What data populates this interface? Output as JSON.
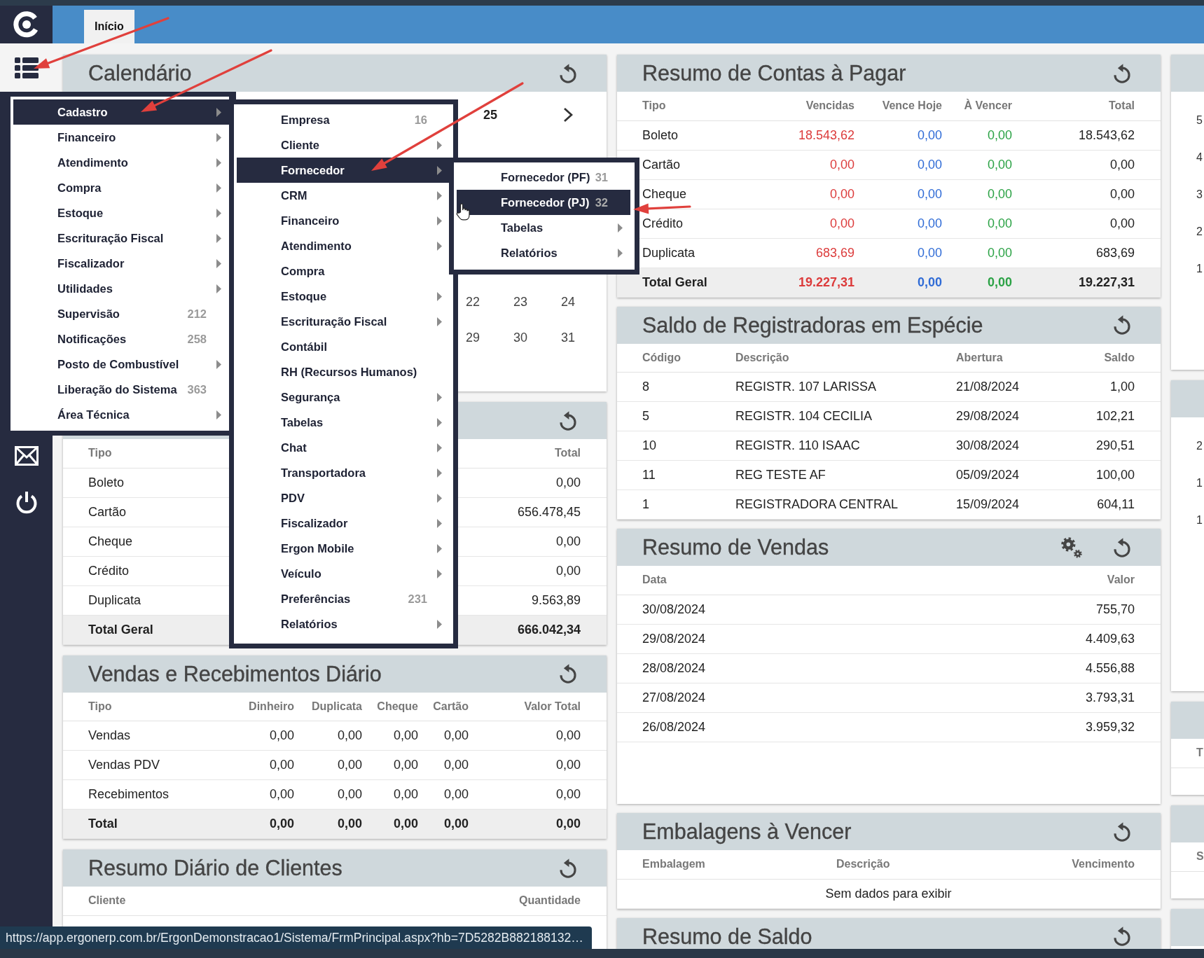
{
  "header": {
    "tabs": [
      {
        "label": "Início",
        "selected": true
      }
    ]
  },
  "menu": {
    "items": [
      {
        "label": "Cadastro",
        "has_submenu": true,
        "selected": true,
        "children": [
          {
            "label": "Empresa",
            "count": "16",
            "has_submenu": false,
            "selected": false
          },
          {
            "label": "Cliente",
            "has_submenu": true,
            "selected": false
          },
          {
            "label": "Fornecedor",
            "has_submenu": true,
            "selected": true,
            "children": [
              {
                "label": "Fornecedor (PF)",
                "count": "31",
                "has_submenu": false,
                "selected": false
              },
              {
                "label": "Fornecedor (PJ)",
                "count": "32",
                "has_submenu": false,
                "selected": true
              },
              {
                "label": "Tabelas",
                "has_submenu": true,
                "selected": false
              },
              {
                "label": "Relatórios",
                "has_submenu": true,
                "selected": false
              }
            ]
          },
          {
            "label": "CRM",
            "has_submenu": true,
            "selected": false
          },
          {
            "label": "Financeiro",
            "has_submenu": true,
            "selected": false
          },
          {
            "label": "Atendimento",
            "has_submenu": true,
            "selected": false
          },
          {
            "label": "Compra",
            "has_submenu": false,
            "selected": false
          },
          {
            "label": "Estoque",
            "has_submenu": true,
            "selected": false
          },
          {
            "label": "Escrituração Fiscal",
            "has_submenu": true,
            "selected": false
          },
          {
            "label": "Contábil",
            "has_submenu": false,
            "selected": false
          },
          {
            "label": "RH (Recursos Humanos)",
            "has_submenu": false,
            "selected": false
          },
          {
            "label": "Segurança",
            "has_submenu": true,
            "selected": false
          },
          {
            "label": "Tabelas",
            "has_submenu": true,
            "selected": false
          },
          {
            "label": "Chat",
            "has_submenu": true,
            "selected": false
          },
          {
            "label": "Transportadora",
            "has_submenu": true,
            "selected": false
          },
          {
            "label": "PDV",
            "has_submenu": true,
            "selected": false
          },
          {
            "label": "Fiscalizador",
            "has_submenu": true,
            "selected": false
          },
          {
            "label": "Ergon Mobile",
            "has_submenu": true,
            "selected": false
          },
          {
            "label": "Veículo",
            "has_submenu": true,
            "selected": false
          },
          {
            "label": "Preferências",
            "count": "231",
            "has_submenu": false,
            "selected": false
          },
          {
            "label": "Relatórios",
            "has_submenu": true,
            "selected": false
          }
        ]
      },
      {
        "label": "Financeiro",
        "has_submenu": true,
        "selected": false
      },
      {
        "label": "Atendimento",
        "has_submenu": true,
        "selected": false
      },
      {
        "label": "Compra",
        "has_submenu": true,
        "selected": false
      },
      {
        "label": "Estoque",
        "has_submenu": true,
        "selected": false
      },
      {
        "label": "Escrituração Fiscal",
        "has_submenu": true,
        "selected": false
      },
      {
        "label": "Fiscalizador",
        "has_submenu": true,
        "selected": false
      },
      {
        "label": "Utilidades",
        "has_submenu": true,
        "selected": false
      },
      {
        "label": "Supervisão",
        "count": "212",
        "has_submenu": false,
        "selected": false
      },
      {
        "label": "Notificações",
        "count": "258",
        "has_submenu": false,
        "selected": false
      },
      {
        "label": "Posto de Combustível",
        "has_submenu": true,
        "selected": false
      },
      {
        "label": "Liberação do Sistema",
        "count": "363",
        "has_submenu": false,
        "selected": false
      },
      {
        "label": "Área Técnica",
        "has_submenu": true,
        "selected": false
      }
    ]
  },
  "dashboard": {
    "columns": [
      {
        "panels": [
          {
            "kind": "calendar",
            "title": "Calendário",
            "refresh_button": true,
            "month_label": "25",
            "weeks": [
              [
                "22",
                "23",
                "24"
              ],
              [
                "29",
                "30",
                "31"
              ]
            ]
          },
          {
            "kind": "table",
            "refresh_button": true,
            "columns": [
              {
                "label": "Tipo",
                "kind": "text"
              },
              {
                "label": "Total",
                "kind": "number"
              }
            ],
            "rows": [
              {
                "cells": [
                  "Boleto",
                  "0,00"
                ],
                "total": false
              },
              {
                "cells": [
                  "Cartão",
                  "656.478,45"
                ],
                "total": false
              },
              {
                "cells": [
                  "Cheque",
                  "0,00"
                ],
                "total": false
              },
              {
                "cells": [
                  "Crédito",
                  "0,00"
                ],
                "total": false
              },
              {
                "cells": [
                  "Duplicata",
                  "9.563,89"
                ],
                "total": false
              },
              {
                "cells": [
                  "Total Geral",
                  "666.042,34"
                ],
                "total": true
              }
            ]
          },
          {
            "kind": "table",
            "title": "Vendas e Recebimentos Diário",
            "refresh_button": true,
            "columns": [
              {
                "label": "Tipo",
                "kind": "text"
              },
              {
                "label": "Dinheiro",
                "kind": "number"
              },
              {
                "label": "Duplicata",
                "kind": "number"
              },
              {
                "label": "Cheque",
                "kind": "number"
              },
              {
                "label": "Cartão",
                "kind": "number"
              },
              {
                "label": "Valor Total",
                "kind": "number"
              }
            ],
            "rows": [
              {
                "cells": [
                  "Vendas",
                  "0,00",
                  "0,00",
                  "0,00",
                  "0,00",
                  "0,00"
                ],
                "total": false
              },
              {
                "cells": [
                  "Vendas PDV",
                  "0,00",
                  "0,00",
                  "0,00",
                  "0,00",
                  "0,00"
                ],
                "total": false
              },
              {
                "cells": [
                  "Recebimentos",
                  "0,00",
                  "0,00",
                  "0,00",
                  "0,00",
                  "0,00"
                ],
                "total": false
              },
              {
                "cells": [
                  "Total",
                  "0,00",
                  "0,00",
                  "0,00",
                  "0,00",
                  "0,00"
                ],
                "total": true
              }
            ]
          },
          {
            "kind": "table",
            "title": "Resumo Diário de Clientes",
            "refresh_button": true,
            "columns": [
              {
                "label": "Cliente",
                "kind": "text"
              },
              {
                "label": "Quantidade",
                "kind": "number"
              }
            ]
          }
        ]
      },
      {
        "panels": [
          {
            "kind": "table",
            "title": "Resumo de Contas à Pagar",
            "refresh_button": true,
            "columns": [
              {
                "label": "Tipo",
                "kind": "text"
              },
              {
                "label": "Vencidas",
                "kind": "number",
                "color": "#dc3b3b"
              },
              {
                "label": "Vence Hoje",
                "kind": "number",
                "color": "#2f6bd6"
              },
              {
                "label": "À Vencer",
                "kind": "number",
                "color": "#2ba245"
              },
              {
                "label": "Total",
                "kind": "number"
              }
            ],
            "rows": [
              {
                "cells": [
                  "Boleto",
                  "18.543,62",
                  "0,00",
                  "0,00",
                  "18.543,62"
                ],
                "total": false
              },
              {
                "cells": [
                  "Cartão",
                  "0,00",
                  "0,00",
                  "0,00",
                  "0,00"
                ],
                "total": false
              },
              {
                "cells": [
                  "Cheque",
                  "0,00",
                  "0,00",
                  "0,00",
                  "0,00"
                ],
                "total": false
              },
              {
                "cells": [
                  "Crédito",
                  "0,00",
                  "0,00",
                  "0,00",
                  "0,00"
                ],
                "total": false
              },
              {
                "cells": [
                  "Duplicata",
                  "683,69",
                  "0,00",
                  "0,00",
                  "683,69"
                ],
                "total": false
              },
              {
                "cells": [
                  "Total Geral",
                  "19.227,31",
                  "0,00",
                  "0,00",
                  "19.227,31"
                ],
                "total": true
              }
            ]
          },
          {
            "kind": "table",
            "title": "Saldo de Registradoras em Espécie",
            "refresh_button": true,
            "columns": [
              {
                "label": "Código",
                "kind": "text"
              },
              {
                "label": "Descrição",
                "kind": "text"
              },
              {
                "label": "Abertura",
                "kind": "date"
              },
              {
                "label": "Saldo",
                "kind": "number"
              }
            ],
            "rows": [
              {
                "cells": [
                  "8",
                  "REGISTR. 107 LARISSA",
                  "21/08/2024",
                  "1,00"
                ],
                "total": false
              },
              {
                "cells": [
                  "5",
                  "REGISTR. 104 CECILIA",
                  "29/08/2024",
                  "102,21"
                ],
                "total": false
              },
              {
                "cells": [
                  "10",
                  "REGISTR. 110 ISAAC",
                  "30/08/2024",
                  "290,51"
                ],
                "total": false
              },
              {
                "cells": [
                  "11",
                  "REG TESTE AF",
                  "05/09/2024",
                  "100,00"
                ],
                "total": false
              },
              {
                "cells": [
                  "1",
                  "REGISTRADORA CENTRAL",
                  "15/09/2024",
                  "604,11"
                ],
                "total": false
              }
            ]
          },
          {
            "kind": "table",
            "title": "Resumo de Vendas",
            "settings_button": true,
            "refresh_button": true,
            "columns": [
              {
                "label": "Data",
                "kind": "date"
              },
              {
                "label": "Valor",
                "kind": "number"
              }
            ],
            "rows": [
              {
                "cells": [
                  "30/08/2024",
                  "755,70"
                ],
                "total": false
              },
              {
                "cells": [
                  "29/08/2024",
                  "4.409,63"
                ],
                "total": false
              },
              {
                "cells": [
                  "28/08/2024",
                  "4.556,88"
                ],
                "total": false
              },
              {
                "cells": [
                  "27/08/2024",
                  "3.793,31"
                ],
                "total": false
              },
              {
                "cells": [
                  "26/08/2024",
                  "3.959,32"
                ],
                "total": false
              }
            ]
          },
          {
            "kind": "table",
            "title": "Embalagens à Vencer",
            "refresh_button": true,
            "columns": [
              {
                "label": "Embalagem",
                "kind": "text"
              },
              {
                "label": "Descrição",
                "kind": "text"
              },
              {
                "label": "Vencimento",
                "kind": "date"
              }
            ],
            "empty_message": "Sem dados para exibir"
          },
          {
            "kind": "table",
            "title": "Resumo de Saldo",
            "refresh_button": true
          }
        ]
      },
      {
        "panels": [
          {
            "kind": "chart",
            "axis_labels": [
              "5",
              "4",
              "3",
              "2",
              "1"
            ]
          },
          {
            "kind": "chart",
            "axis_labels": [
              "2",
              "1",
              "1"
            ]
          },
          {
            "kind": "table",
            "columns": [
              {
                "label": "T",
                "kind": "text"
              }
            ]
          },
          {
            "kind": "table",
            "columns": [
              {
                "label": "S",
                "kind": "text"
              }
            ]
          },
          {
            "kind": "table"
          }
        ]
      }
    ]
  },
  "link_preview": "https://app.ergonerp.com.br/ErgonDemonstracao1/Sistema/FrmPrincipal.aspx?hb=7D5282B882188132…",
  "annotations": [
    {
      "kind": "arrow"
    },
    {
      "kind": "arrow"
    },
    {
      "kind": "arrow"
    },
    {
      "kind": "arrow"
    }
  ]
}
